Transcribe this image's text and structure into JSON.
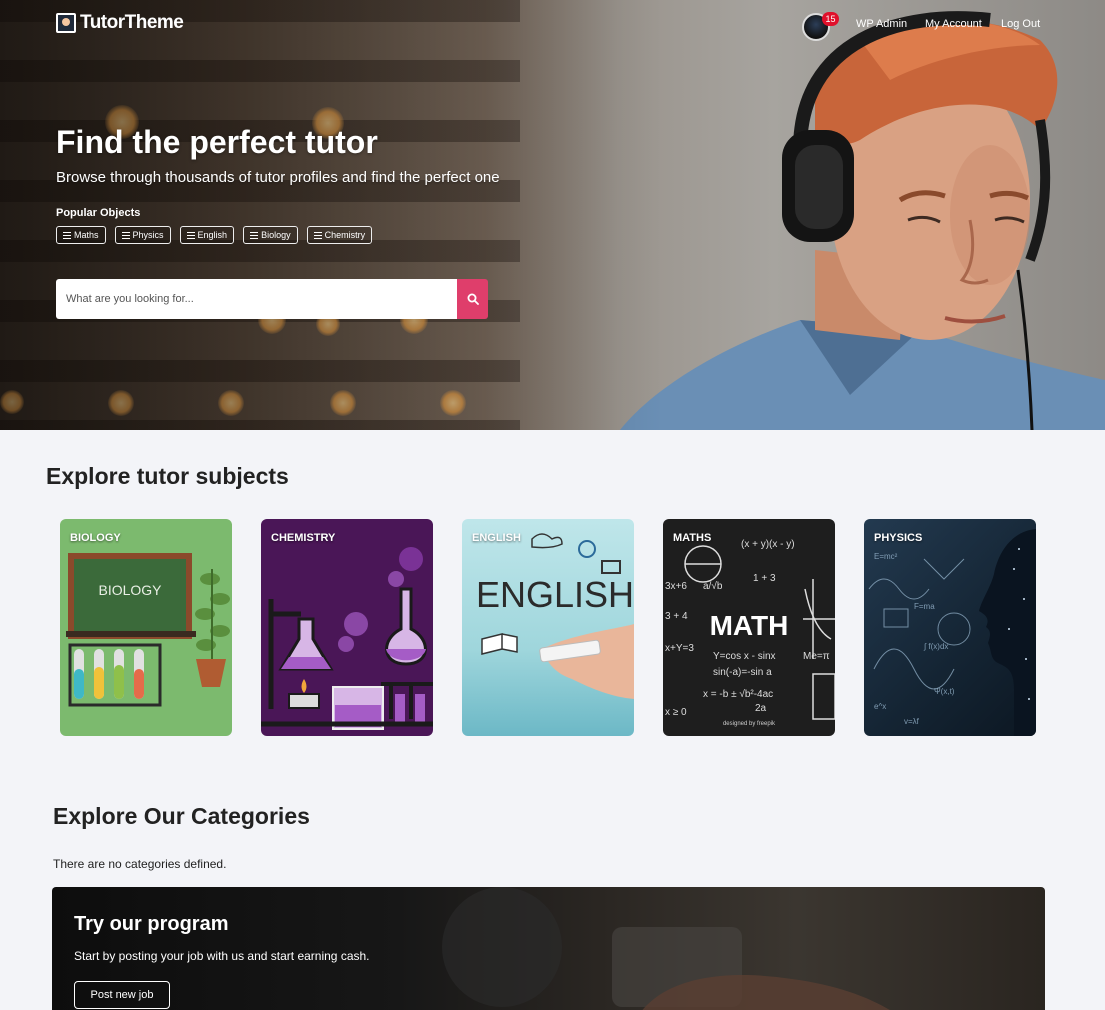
{
  "header": {
    "logo_text": "TutorTheme",
    "notification_count": "15",
    "nav_links": [
      "WP Admin",
      "My Account",
      "Log Out"
    ]
  },
  "hero": {
    "title": "Find the perfect tutor",
    "subtitle": "Browse through thousands of tutor profiles and find the perfect one",
    "popular_label": "Popular Objects",
    "tags": [
      "Maths",
      "Physics",
      "English",
      "Biology",
      "Chemistry"
    ],
    "search_placeholder": "What are you looking for...",
    "search_button_icon": "search-icon"
  },
  "subjects": {
    "title": "Explore tutor subjects",
    "cards": [
      {
        "label": "BIOLOGY",
        "color": "#7cba6e"
      },
      {
        "label": "CHEMISTRY",
        "color": "#4a1657"
      },
      {
        "label": "ENGLISH",
        "color": "#a8dde2"
      },
      {
        "label": "MATHS",
        "color": "#1e1e1e"
      },
      {
        "label": "PHYSICS",
        "color": "#172838"
      }
    ],
    "card_texts": {
      "biology_board": "BIOLOGY",
      "english_word": "ENGLISH",
      "math_word": "MATH",
      "freepik_credit": "designed by freepik"
    }
  },
  "categories": {
    "title": "Explore Our Categories",
    "empty_text": "There are no categories defined."
  },
  "program": {
    "title": "Try our program",
    "subtitle": "Start by posting your job with us and start earning cash.",
    "button": "Post new job"
  },
  "colors": {
    "accent": "#df3e6b",
    "badge": "#e0102b",
    "page_bg": "#f3f4f8"
  }
}
